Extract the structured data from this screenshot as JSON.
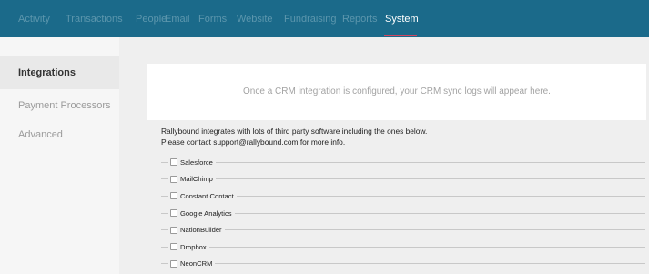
{
  "topnav": {
    "items": [
      "Activity",
      "Transactions",
      "People",
      "Email",
      "Forms",
      "Website",
      "Fundraising",
      "Reports",
      "System"
    ],
    "active": "System"
  },
  "sidebar": {
    "items": [
      {
        "label": "Integrations",
        "active": true
      },
      {
        "label": "Payment Processors",
        "active": false
      },
      {
        "label": "Advanced",
        "active": false
      }
    ]
  },
  "main": {
    "banner_text": "Once a CRM integration is configured, your CRM sync logs will appear here.",
    "intro_line1": "Rallybound integrates with lots of third party software including the ones below.",
    "intro_line2": "Please contact support@rallybound.com for more info.",
    "integrations": [
      "Salesforce",
      "MailChimp",
      "Constant Contact",
      "Google Analytics",
      "NationBuilder",
      "Dropbox",
      "NeonCRM"
    ]
  },
  "colors": {
    "nav_bg": "#1b6a8a",
    "nav_active_underline": "#d4465f"
  }
}
